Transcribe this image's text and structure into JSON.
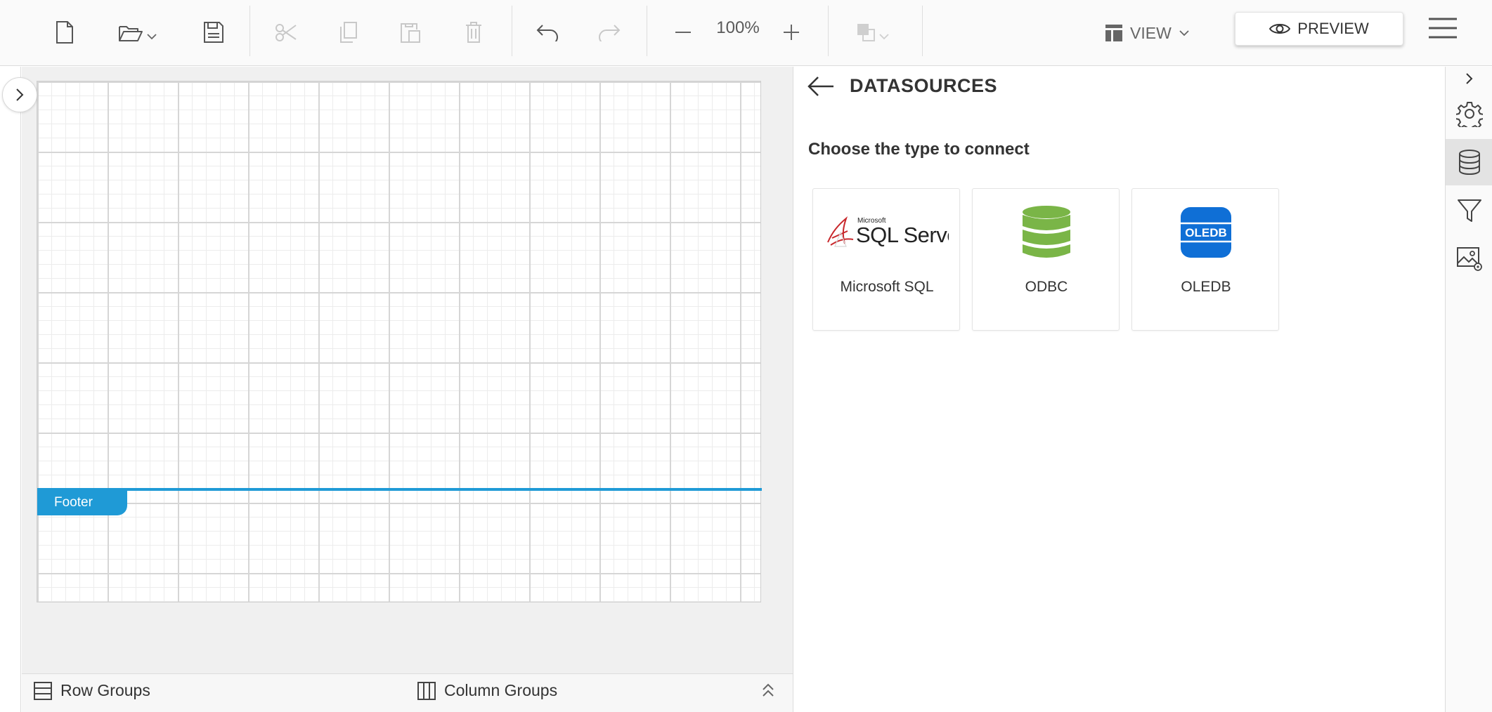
{
  "toolbar": {
    "zoom_value": "100%",
    "view_label": "VIEW",
    "preview_label": "PREVIEW"
  },
  "canvas": {
    "footer_label": "Footer"
  },
  "groups": {
    "row_groups_label": "Row Groups",
    "column_groups_label": "Column Groups"
  },
  "datasources": {
    "title": "DATASOURCES",
    "subtitle": "Choose the type to connect",
    "options": [
      {
        "label": "Microsoft SQL",
        "logo_brand": "Microsoft",
        "logo_text": "SQL Server"
      },
      {
        "label": "ODBC"
      },
      {
        "label": "OLEDB",
        "logo_text": "OLEDB"
      }
    ]
  },
  "colors": {
    "accent_blue": "#1f9ad6",
    "odbc_green": "#7ab547",
    "oledb_blue": "#0f6fd6",
    "sql_red": "#c8282c"
  }
}
